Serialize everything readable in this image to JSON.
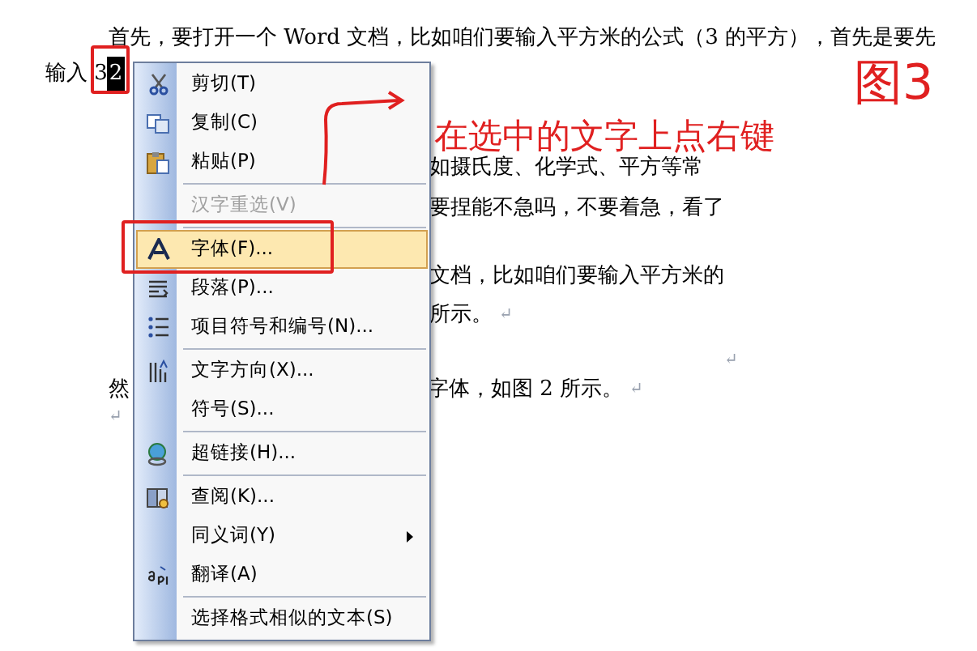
{
  "document": {
    "first_line": "首先，要打开一个 Word 文档，比如咱们要输入平方米的公式（3 的平方），首先是要先",
    "second_line": {
      "before": "输入 3",
      "selected": "2"
    },
    "fragments": [
      {
        "text": "如摄氏度、化学式、平方等常"
      },
      {
        "text": "要捏能不急吗，不要着急，看了"
      },
      {
        "text": "文档，比如咱们要输入平方米的"
      },
      {
        "text": "所示。",
        "mark": "↵"
      }
    ],
    "lone_mark": "↵",
    "last_line": {
      "left": "然",
      "right": "字体，如图 2 所示。",
      "mark": "↵"
    },
    "end_mark": "↵"
  },
  "context_menu": {
    "groups": [
      [
        {
          "label": "剪切(T)",
          "disabled": false,
          "selected": false,
          "submenu": false
        },
        {
          "label": "复制(C)",
          "disabled": false,
          "selected": false,
          "submenu": false
        },
        {
          "label": "粘贴(P)",
          "disabled": false,
          "selected": false,
          "submenu": false
        }
      ],
      [
        {
          "label": "汉字重选(V)",
          "disabled": true,
          "selected": false,
          "submenu": false
        }
      ],
      [
        {
          "label": "字体(F)...",
          "disabled": false,
          "selected": true,
          "submenu": false
        },
        {
          "label": "段落(P)...",
          "disabled": false,
          "selected": false,
          "submenu": false
        },
        {
          "label": "项目符号和编号(N)...",
          "disabled": false,
          "selected": false,
          "submenu": false
        }
      ],
      [
        {
          "label": "文字方向(X)...",
          "disabled": false,
          "selected": false,
          "submenu": false
        },
        {
          "label": "符号(S)...",
          "disabled": false,
          "selected": false,
          "submenu": false
        }
      ],
      [
        {
          "label": "超链接(H)...",
          "disabled": false,
          "selected": false,
          "submenu": false
        }
      ],
      [
        {
          "label": "查阅(K)...",
          "disabled": false,
          "selected": false,
          "submenu": false
        },
        {
          "label": "同义词(Y)",
          "disabled": false,
          "selected": false,
          "submenu": true
        },
        {
          "label": "翻译(A)",
          "disabled": false,
          "selected": false,
          "submenu": false
        }
      ],
      [
        {
          "label": "选择格式相似的文本(S)",
          "disabled": false,
          "selected": false,
          "submenu": false
        }
      ]
    ]
  },
  "annotations": {
    "callout": "在选中的文字上点右键",
    "figure_label": "图3"
  }
}
